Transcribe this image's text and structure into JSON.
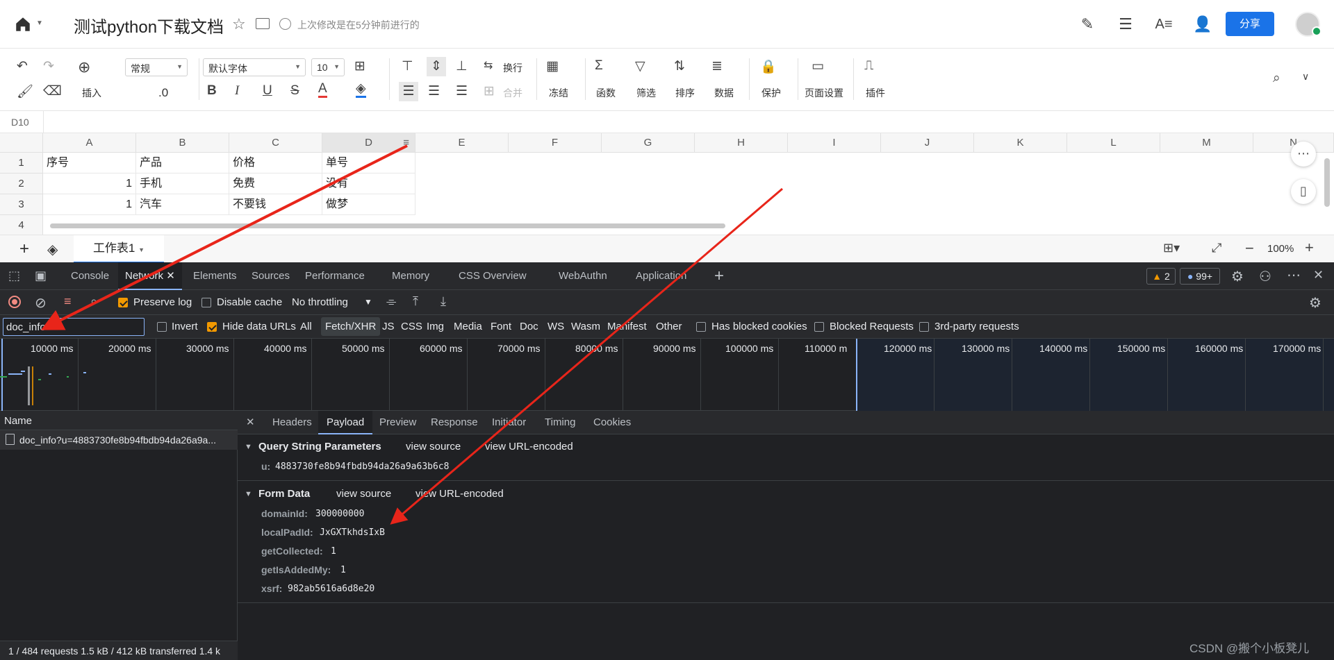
{
  "titlebar": {
    "doc_title": "测试python下载文档",
    "save_status": "上次修改是在5分钟前进行的",
    "share_label": "分享"
  },
  "ribbon": {
    "insert": "插入",
    "format_value": "常规",
    "decimal_value": ".0",
    "font_family": "默认字体",
    "font_size": "10",
    "wrap": "换行",
    "merge": "合并",
    "freeze": "冻结",
    "function": "函数",
    "filter": "筛选",
    "sort": "排序",
    "data": "数据",
    "protect": "保护",
    "page_setup": "页面设置",
    "plugin": "插件"
  },
  "formula_bar": {
    "cell_ref": "D10"
  },
  "grid": {
    "columns": [
      "A",
      "B",
      "C",
      "D",
      "E",
      "F",
      "G",
      "H",
      "I",
      "J",
      "K",
      "L",
      "M",
      "N"
    ],
    "rows": [
      {
        "num": "1",
        "cells": [
          "序号",
          "产品",
          "价格",
          "单号"
        ]
      },
      {
        "num": "2",
        "cells": [
          "1",
          "手机",
          "免费",
          "没有"
        ]
      },
      {
        "num": "3",
        "cells": [
          "1",
          "汽车",
          "不要钱",
          "做梦"
        ]
      },
      {
        "num": "4",
        "cells": [
          "",
          "",
          "",
          ""
        ]
      }
    ]
  },
  "sheetbar": {
    "tab": "工作表1",
    "zoom": "100%"
  },
  "devtools": {
    "tabs": [
      "Console",
      "Network",
      "Elements",
      "Sources",
      "Performance",
      "Memory",
      "CSS Overview",
      "WebAuthn",
      "Application"
    ],
    "warnings": "2",
    "issues": "99+",
    "toolbar": {
      "preserve_log": "Preserve log",
      "disable_cache": "Disable cache",
      "throttling": "No throttling"
    },
    "filter": {
      "value": "doc_info",
      "invert": "Invert",
      "hide_data_urls": "Hide data URLs",
      "types": [
        "All",
        "Fetch/XHR",
        "JS",
        "CSS",
        "Img",
        "Media",
        "Font",
        "Doc",
        "WS",
        "Wasm",
        "Manifest",
        "Other"
      ],
      "blocked_cookies": "Has blocked cookies",
      "blocked_requests": "Blocked Requests",
      "third_party": "3rd-party requests"
    },
    "timeline_ticks": [
      "10000 ms",
      "20000 ms",
      "30000 ms",
      "40000 ms",
      "50000 ms",
      "60000 ms",
      "70000 ms",
      "80000 ms",
      "90000 ms",
      "100000 ms",
      "110000 m",
      "120000 ms",
      "130000 ms",
      "140000 ms",
      "150000 ms",
      "160000 ms",
      "170000 ms"
    ],
    "requests": {
      "header": "Name",
      "items": [
        "doc_info?u=4883730fe8b94fbdb94da26a9a..."
      ],
      "footer": "1 / 484 requests   1.5 kB / 412 kB transferred   1.4 k"
    },
    "detail_tabs": [
      "Headers",
      "Payload",
      "Preview",
      "Response",
      "Initiator",
      "Timing",
      "Cookies"
    ],
    "query": {
      "title": "Query String Parameters",
      "view_source": "view source",
      "view_url_encoded": "view URL-encoded",
      "params": [
        {
          "k": "u:",
          "v": "4883730fe8b94fbdb94da26a9a63b6c8"
        }
      ]
    },
    "form": {
      "title": "Form Data",
      "view_source": "view source",
      "view_url_encoded": "view URL-encoded",
      "params": [
        {
          "k": "domainId:",
          "v": "300000000"
        },
        {
          "k": "localPadId:",
          "v": "JxGXTkhdsIxB"
        },
        {
          "k": "getCollected:",
          "v": "1"
        },
        {
          "k": "getIsAddedMy:",
          "v": "1"
        },
        {
          "k": "xsrf:",
          "v": "982ab5616a6d8e20"
        }
      ]
    }
  },
  "watermark": "CSDN @搬个小板凳儿",
  "colors": {
    "accent": "#1a73e8",
    "devtools_bg": "#202124",
    "arrow": "#e8251a",
    "checkbox_on": "#f29900"
  }
}
